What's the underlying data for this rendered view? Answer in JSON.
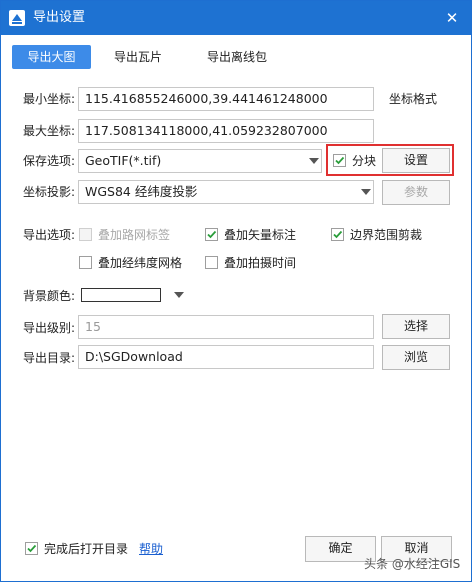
{
  "window": {
    "title": "导出设置",
    "close_glyph": "✕"
  },
  "tabs": [
    {
      "label": "导出大图",
      "active": true
    },
    {
      "label": "导出瓦片",
      "active": false
    },
    {
      "label": "导出离线包",
      "active": false
    }
  ],
  "coords": {
    "min_label": "最小坐标:",
    "min_value": "115.416855246000,39.441461248000",
    "max_label": "最大坐标:",
    "max_value": "117.508134118000,41.059232807000",
    "format_label": "坐标格式"
  },
  "save": {
    "label": "保存选项:",
    "value": "GeoTIF(*.tif)",
    "tile_label": "分块",
    "tile_checked": true,
    "settings_button": "设置"
  },
  "projection": {
    "label": "坐标投影:",
    "value": "WGS84 经纬度投影",
    "params_button": "参数"
  },
  "export_options": {
    "label": "导出选项:",
    "items": [
      {
        "label": "叠加路网标签",
        "checked": false,
        "disabled": true
      },
      {
        "label": "叠加矢量标注",
        "checked": true,
        "disabled": false
      },
      {
        "label": "边界范围剪裁",
        "checked": true,
        "disabled": false
      },
      {
        "label": "叠加经纬度网格",
        "checked": false,
        "disabled": false
      },
      {
        "label": "叠加拍摄时间",
        "checked": false,
        "disabled": false
      }
    ]
  },
  "background": {
    "label": "背景颜色:",
    "color": "#ffffff"
  },
  "level": {
    "label": "导出级别:",
    "value": "15",
    "select_button": "选择"
  },
  "directory": {
    "label": "导出目录:",
    "value": "D:\\SGDownload",
    "browse_button": "浏览"
  },
  "footer": {
    "open_dir_label": "完成后打开目录",
    "open_dir_checked": true,
    "help_link": "帮助",
    "ok_button": "确定",
    "cancel_button": "取消"
  },
  "watermark": "头条 @水经注GIS",
  "colors": {
    "titlebar": "#1e72d2",
    "tab_active": "#3d8be8",
    "highlight": "#e03030",
    "check": "#2a9d3a",
    "link": "#1a5fd0"
  }
}
